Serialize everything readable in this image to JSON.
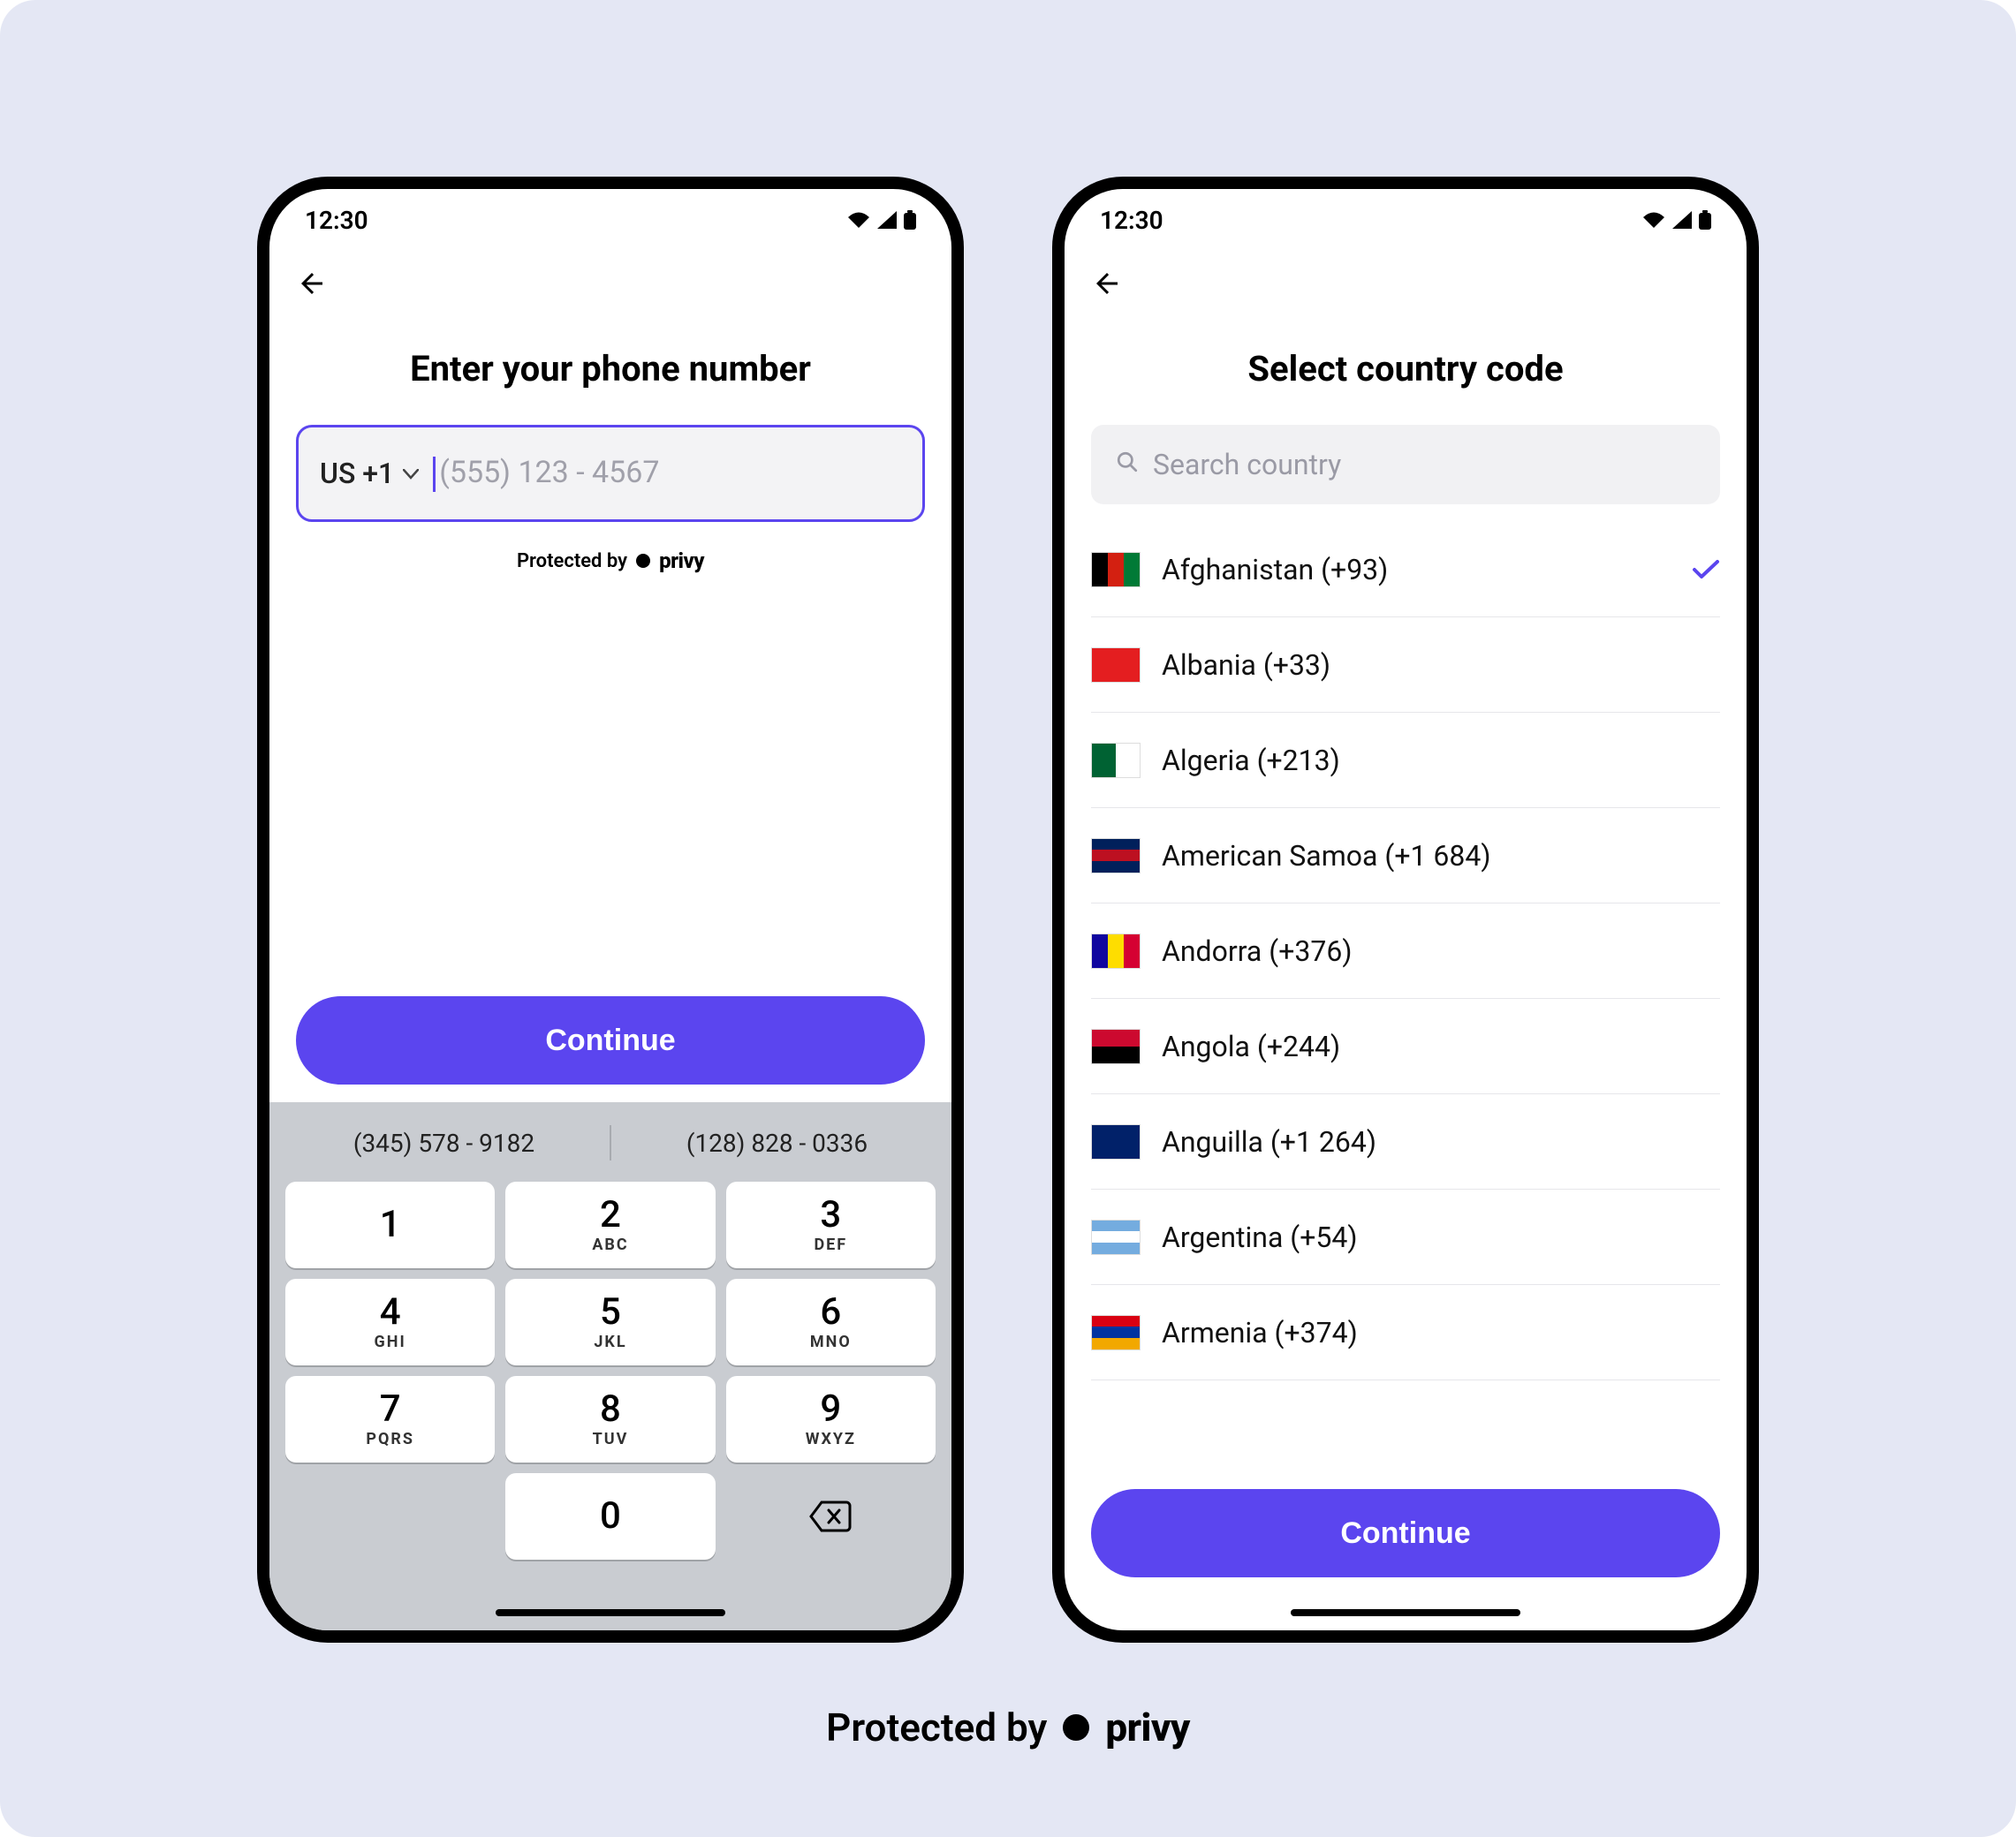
{
  "colors": {
    "accent": "#5b45ef",
    "canvas": "#e4e7f4",
    "keyboard_bg": "#c9ccd1"
  },
  "status": {
    "time": "12:30"
  },
  "screen1": {
    "title": "Enter your phone number",
    "country_code_label": "US +1",
    "phone_placeholder": "(555) 123 - 4567",
    "protected_label": "Protected by",
    "brand": "privy",
    "continue_label": "Continue",
    "suggestions": [
      "(345) 578 - 9182",
      "(128) 828 - 0336"
    ],
    "keypad": [
      {
        "digit": "1",
        "letters": ""
      },
      {
        "digit": "2",
        "letters": "ABC"
      },
      {
        "digit": "3",
        "letters": "DEF"
      },
      {
        "digit": "4",
        "letters": "GHI"
      },
      {
        "digit": "5",
        "letters": "JKL"
      },
      {
        "digit": "6",
        "letters": "MNO"
      },
      {
        "digit": "7",
        "letters": "PQRS"
      },
      {
        "digit": "8",
        "letters": "TUV"
      },
      {
        "digit": "9",
        "letters": "WXYZ"
      }
    ],
    "zero": {
      "digit": "0",
      "letters": ""
    }
  },
  "screen2": {
    "title": "Select country code",
    "search_placeholder": "Search country",
    "continue_label": "Continue",
    "countries": [
      {
        "name": "Afghanistan",
        "code": "+93",
        "selected": true,
        "flag": [
          "#000000",
          "#d32011",
          "#007a36"
        ],
        "dir": "h"
      },
      {
        "name": "Albania",
        "code": "+33",
        "selected": false,
        "flag": [
          "#e41e20",
          "#e41e20",
          "#e41e20"
        ],
        "dir": "h"
      },
      {
        "name": "Algeria",
        "code": "+213",
        "selected": false,
        "flag": [
          "#006233",
          "#ffffff"
        ],
        "dir": "h"
      },
      {
        "name": "American Samoa",
        "code": "+1 684",
        "selected": false,
        "flag": [
          "#00205b",
          "#bd1021",
          "#00205b"
        ],
        "dir": "v"
      },
      {
        "name": "Andorra",
        "code": "+376",
        "selected": false,
        "flag": [
          "#10069f",
          "#fedd00",
          "#d50032"
        ],
        "dir": "h"
      },
      {
        "name": "Angola",
        "code": "+244",
        "selected": false,
        "flag": [
          "#cc092f",
          "#000000"
        ],
        "dir": "v"
      },
      {
        "name": "Anguilla",
        "code": "+1 264",
        "selected": false,
        "flag": [
          "#012169",
          "#012169"
        ],
        "dir": "h"
      },
      {
        "name": "Argentina",
        "code": "+54",
        "selected": false,
        "flag": [
          "#74acdf",
          "#ffffff",
          "#74acdf"
        ],
        "dir": "v"
      },
      {
        "name": "Armenia",
        "code": "+374",
        "selected": false,
        "flag": [
          "#d90012",
          "#0033a0",
          "#f2a800"
        ],
        "dir": "v"
      }
    ]
  },
  "footer": {
    "label": "Protected by",
    "brand": "privy"
  }
}
